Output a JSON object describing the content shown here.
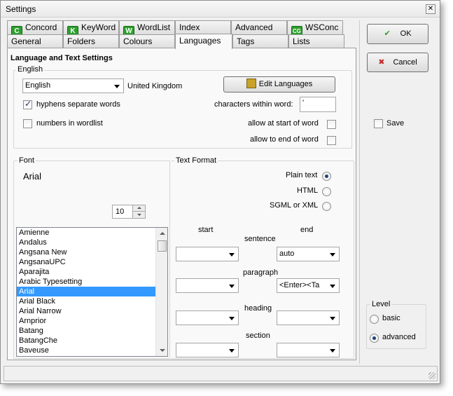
{
  "window": {
    "title": "Settings",
    "close_glyph": "✕"
  },
  "tabs_row1": [
    {
      "label": "Concord",
      "icon": "C"
    },
    {
      "label": "KeyWord",
      "icon": "K"
    },
    {
      "label": "WordList",
      "icon": "W"
    },
    {
      "label": "Index"
    },
    {
      "label": "Advanced"
    },
    {
      "label": "WSConc",
      "icon": "CG"
    }
  ],
  "tabs_row2": [
    {
      "label": "General"
    },
    {
      "label": "Folders"
    },
    {
      "label": "Colours"
    },
    {
      "label": "Languages"
    },
    {
      "label": "Tags"
    },
    {
      "label": "Lists"
    }
  ],
  "language_group": {
    "title": "Language and Text Settings",
    "sub_title": "English",
    "language_combo": "English",
    "region": "United Kingdom",
    "edit_button": "Edit Languages",
    "hyphens_label": "hyphens separate words",
    "numbers_label": "numbers in wordlist",
    "chars_label": "characters within word:",
    "chars_value": "'",
    "start_label": "allow at start of word",
    "end_label": "allow to end of word"
  },
  "font_group": {
    "title": "Font",
    "preview": "Arial",
    "size": "10",
    "fonts": [
      "Amienne",
      "Andalus",
      "Angsana New",
      "AngsanaUPC",
      "Aparajita",
      "Arabic Typesetting",
      "Arial",
      "Arial Black",
      "Arial Narrow",
      "Arnprior",
      "Batang",
      "BatangChe",
      "Baveuse"
    ],
    "selected_font": "Arial"
  },
  "text_format": {
    "title": "Text Format",
    "plain_text": "Plain text",
    "html": "HTML",
    "sgml": "SGML or XML",
    "start_col": "start",
    "end_col": "end",
    "sentence": "sentence",
    "paragraph": "paragraph",
    "heading": "heading",
    "section": "section",
    "sentence_end": "auto",
    "paragraph_end": "<Enter><Ta"
  },
  "sidebar": {
    "ok": "OK",
    "cancel": "Cancel",
    "save": "Save",
    "level_title": "Level",
    "basic": "basic",
    "advanced": "advanced"
  },
  "colors": {
    "accent_green": "#2e9e2e",
    "selection": "#3399ff"
  }
}
